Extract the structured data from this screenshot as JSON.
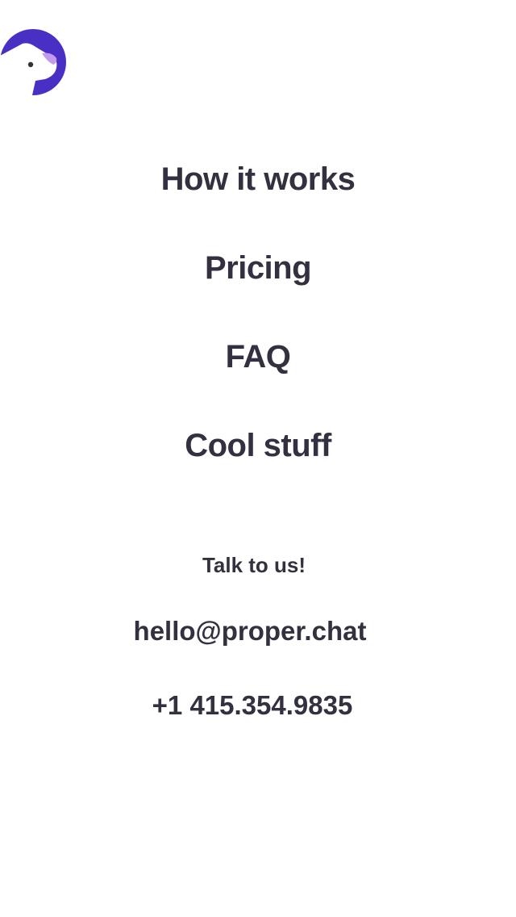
{
  "logo": {
    "icon": "dog-head-logo-icon",
    "colors": {
      "circle": "#4a2fc4",
      "face": "#ffffff",
      "ear": "#c49af0",
      "eye": "#34303f"
    }
  },
  "nav": {
    "items": [
      {
        "label": "How it works"
      },
      {
        "label": "Pricing"
      },
      {
        "label": "FAQ"
      },
      {
        "label": "Cool stuff"
      }
    ]
  },
  "contact": {
    "heading": "Talk to us!",
    "email": "hello@proper.chat",
    "phone": "+1 415.354.9835"
  },
  "colors": {
    "text": "#34303f",
    "background": "#ffffff"
  }
}
